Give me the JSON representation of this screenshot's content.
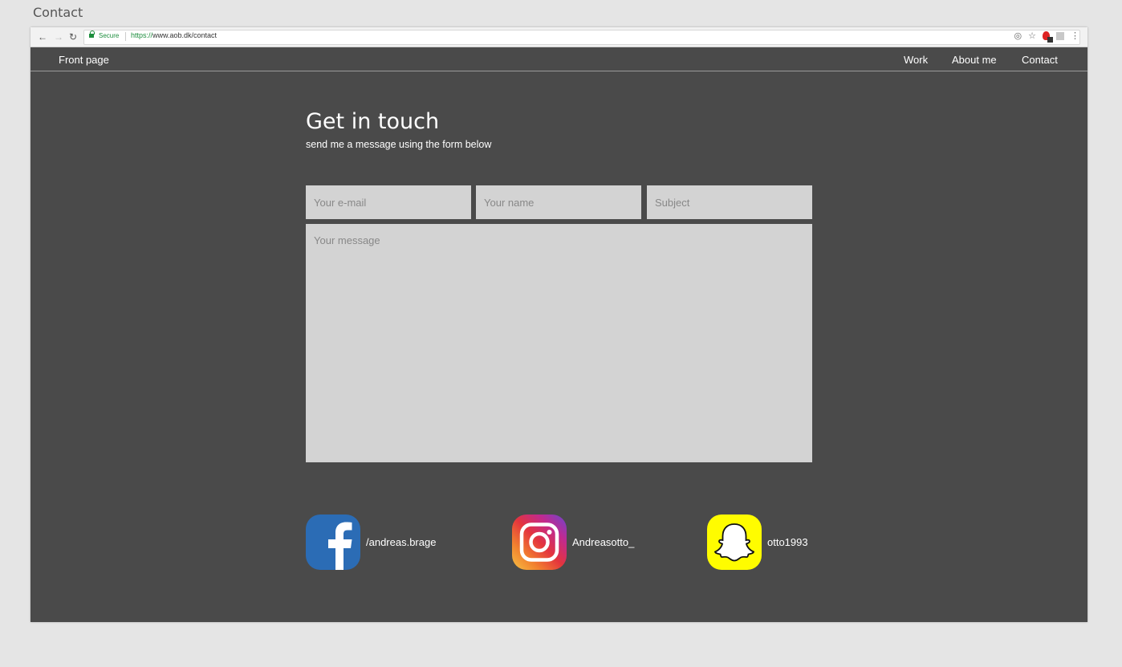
{
  "page_label": "Contact",
  "browser": {
    "secure_label": "Secure",
    "url_scheme": "https://",
    "url_rest": "www.aob.dk/contact"
  },
  "nav": {
    "brand": "Front page",
    "work": "Work",
    "about": "About me",
    "contact": "Contact"
  },
  "header": {
    "title": "Get in touch",
    "subtitle": "send me a message using the form below"
  },
  "form": {
    "email_placeholder": "Your e-mail",
    "name_placeholder": "Your name",
    "subject_placeholder": "Subject",
    "message_placeholder": "Your message"
  },
  "social": [
    {
      "network": "facebook",
      "icon": "facebook-icon",
      "handle": "/andreas.brage",
      "color": "#2b6cb5"
    },
    {
      "network": "instagram",
      "icon": "instagram-icon",
      "handle": "Andreasotto_",
      "color": "#e4343d"
    },
    {
      "network": "snapchat",
      "icon": "snapchat-icon",
      "handle": "otto1993",
      "color": "#fffc00"
    }
  ],
  "colors": {
    "page_background": "#4a4a4a",
    "field_background": "#d3d3d3"
  }
}
